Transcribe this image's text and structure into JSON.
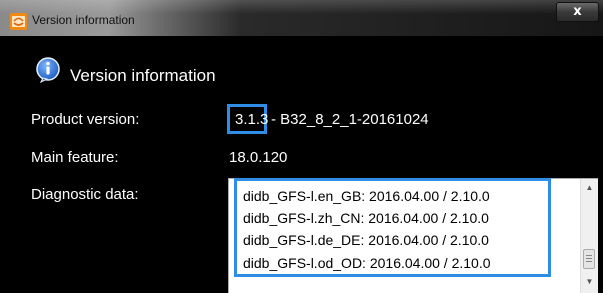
{
  "window": {
    "title": "Version information",
    "close_label": "x"
  },
  "header": {
    "title": "Version information"
  },
  "fields": {
    "product_version_label": "Product version:",
    "product_version_number": "3.1.3",
    "product_version_suffix": "- B32_8_2_1-20161024",
    "main_feature_label": "Main feature:",
    "main_feature_value": "18.0.120",
    "diagnostic_label": "Diagnostic data:"
  },
  "diagnostic_data": [
    "didb_GFS-l.en_GB: 2016.04.00 / 2.10.0",
    "didb_GFS-l.zh_CN: 2016.04.00 / 2.10.0",
    "didb_GFS-l.de_DE: 2016.04.00 / 2.10.0",
    "didb_GFS-l.od_OD: 2016.04.00 / 2.10.0"
  ],
  "colors": {
    "highlight": "#2e8de4",
    "background": "#000000",
    "info_icon": "#2e6fd0"
  },
  "icons": {
    "app": "app-logo-icon",
    "info": "info-icon",
    "close": "close-icon"
  }
}
